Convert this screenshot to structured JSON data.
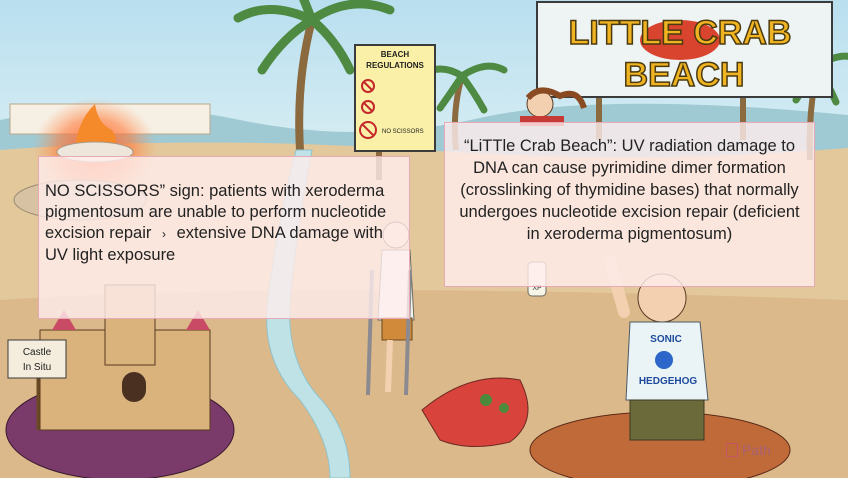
{
  "scene": {
    "regulations_sign": {
      "title_line1": "BEACH",
      "title_line2": "REGULATIONS",
      "no_scissors_label": "NO SCISSORS"
    },
    "crab_sign": {
      "line1": "LITTLE CRAB",
      "line2": "BEACH"
    },
    "castle_sign": {
      "line1": "Castle",
      "line2": "In Situ"
    },
    "shirt": {
      "line1": "SONIC",
      "line2": "HEDGEHOG"
    },
    "lotion_label": "XP"
  },
  "popups": {
    "left": {
      "line1": "NO SCISSORS” sign: patients with xeroderma pigmentosum are unable to perform nucleotide excision repair",
      "arrow": "›",
      "line2": "extensive DNA damage with UV light exposure"
    },
    "right": {
      "text": "“LiTTle Crab Beach”: UV radiation damage to DNA can cause pyrimidine dimer formation (crosslinking of thymidine bases) that normally undergoes nucleotide excision repair (deficient in xeroderma pigmentosum)"
    }
  },
  "watermark": {
    "brand": "Path"
  },
  "colors": {
    "sky": "#b9dfef",
    "sand": "#e3c89c",
    "water": "#bfe2e6",
    "popup_bg": "#ffeeee",
    "popup_border": "#e7a9b6",
    "crab": "#d8442e",
    "sign_text": "#f0b321"
  }
}
